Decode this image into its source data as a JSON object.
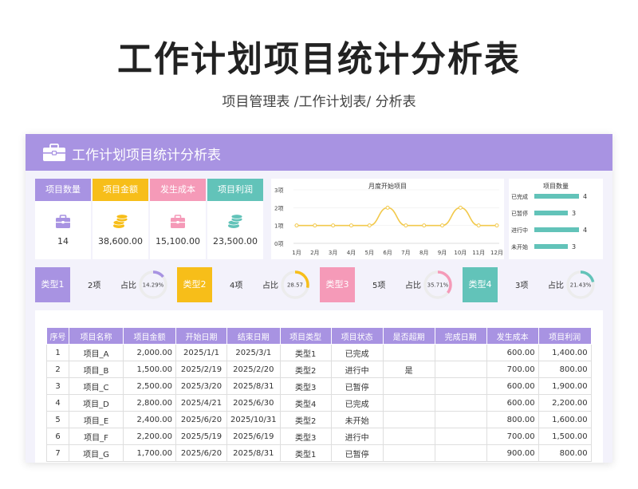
{
  "main_title": "工作计划项目统计分析表",
  "sub_title": "项目管理表 /工作计划表/ 分析表",
  "sheet_title": "工作计划项目统计分析表",
  "colors": {
    "purple": "#a893e2",
    "yellow": "#f7be19",
    "pink": "#f59ab8",
    "teal": "#62c3b9",
    "line": "#f2c94c",
    "bar": "#62c3b9"
  },
  "cards": [
    {
      "label": "项目数量",
      "value": "14",
      "icon": "briefcase-icon",
      "color": "#a893e2"
    },
    {
      "label": "项目金额",
      "value": "38,600.00",
      "icon": "coins-icon",
      "color": "#f7be19"
    },
    {
      "label": "发生成本",
      "value": "15,100.00",
      "icon": "briefcase-icon",
      "color": "#f59ab8"
    },
    {
      "label": "项目利润",
      "value": "23,500.00",
      "icon": "coins-icon",
      "color": "#62c3b9"
    }
  ],
  "chart_data": [
    {
      "type": "line",
      "title": "月度开始项目",
      "categories": [
        "1月",
        "2月",
        "3月",
        "4月",
        "5月",
        "6月",
        "7月",
        "8月",
        "9月",
        "10月",
        "11月",
        "12月"
      ],
      "values": [
        1,
        1,
        1,
        1,
        1,
        2,
        1,
        1,
        1,
        2,
        1,
        1
      ],
      "yticks": [
        "0项",
        "1项",
        "2项",
        "3项"
      ],
      "ylim": [
        0,
        3
      ]
    },
    {
      "type": "bar",
      "title": "项目数量",
      "categories": [
        "已完成",
        "已暂停",
        "进行中",
        "未开始"
      ],
      "values": [
        4,
        3,
        4,
        3
      ],
      "labels": [
        "4",
        "3",
        "4",
        "3"
      ],
      "xlim": [
        0,
        4
      ]
    }
  ],
  "types": [
    {
      "name": "类型1",
      "count": "2项",
      "pct_label": "占比",
      "pct_text": "14.29%",
      "pct": 14.29,
      "color": "#a893e2"
    },
    {
      "name": "类型2",
      "count": "4项",
      "pct_label": "占比",
      "pct_text": "28.57",
      "pct": 28.57,
      "color": "#f7be19"
    },
    {
      "name": "类型3",
      "count": "5项",
      "pct_label": "占比",
      "pct_text": "35.71%",
      "pct": 35.71,
      "color": "#f59ab8"
    },
    {
      "name": "类型4",
      "count": "3项",
      "pct_label": "占比",
      "pct_text": "21.43%",
      "pct": 21.43,
      "color": "#62c3b9"
    }
  ],
  "table": {
    "headers": [
      "序号",
      "项目名称",
      "项目金额",
      "开始日期",
      "结束日期",
      "项目类型",
      "项目状态",
      "是否超期",
      "完成日期",
      "发生成本",
      "项目利润"
    ],
    "rows": [
      [
        "1",
        "项目_A",
        "2,000.00",
        "2025/1/1",
        "2025/3/1",
        "类型1",
        "已完成",
        "",
        "",
        "600.00",
        "1,400.00"
      ],
      [
        "2",
        "项目_B",
        "1,500.00",
        "2025/2/19",
        "2025/2/20",
        "类型2",
        "进行中",
        "是",
        "",
        "700.00",
        "800.00"
      ],
      [
        "3",
        "项目_C",
        "2,500.00",
        "2025/3/20",
        "2025/8/31",
        "类型3",
        "已暂停",
        "",
        "",
        "600.00",
        "1,900.00"
      ],
      [
        "4",
        "项目_D",
        "2,800.00",
        "2025/4/21",
        "2025/6/30",
        "类型4",
        "已完成",
        "",
        "",
        "600.00",
        "2,200.00"
      ],
      [
        "5",
        "项目_E",
        "2,400.00",
        "2025/6/20",
        "2025/10/31",
        "类型2",
        "未开始",
        "",
        "",
        "800.00",
        "1,600.00"
      ],
      [
        "6",
        "项目_F",
        "2,200.00",
        "2025/5/19",
        "2025/6/19",
        "类型3",
        "进行中",
        "",
        "",
        "700.00",
        "1,500.00"
      ],
      [
        "7",
        "项目_G",
        "1,700.00",
        "2025/6/20",
        "2025/8/31",
        "类型1",
        "已暂停",
        "",
        "",
        "900.00",
        "800.00"
      ]
    ]
  }
}
